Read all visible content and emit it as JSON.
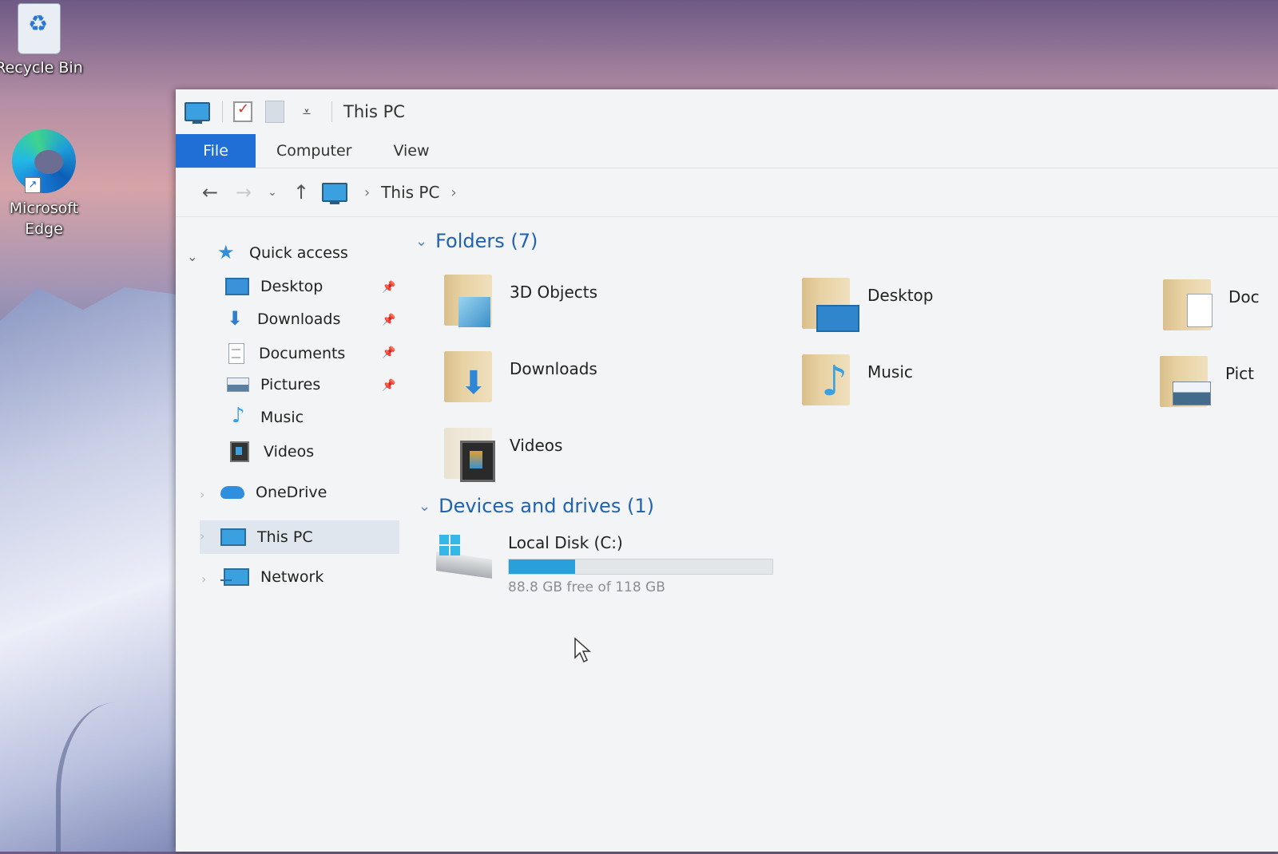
{
  "desktop": {
    "icons": [
      {
        "label": "Recycle Bin",
        "icon": "recycle-bin-icon"
      },
      {
        "label": "Microsoft Edge",
        "icon": "edge-icon"
      }
    ]
  },
  "window": {
    "title": "This PC",
    "ribbon_tabs": [
      {
        "label": "File"
      },
      {
        "label": "Computer"
      },
      {
        "label": "View"
      }
    ],
    "address": {
      "crumbs": [
        "This PC"
      ]
    }
  },
  "nav": {
    "quick_access": "Quick access",
    "quick_items": [
      {
        "label": "Desktop",
        "icon": "desktop-icon",
        "pinned": true
      },
      {
        "label": "Downloads",
        "icon": "downloads-icon",
        "pinned": true
      },
      {
        "label": "Documents",
        "icon": "documents-icon",
        "pinned": true
      },
      {
        "label": "Pictures",
        "icon": "pictures-icon",
        "pinned": true
      },
      {
        "label": "Music",
        "icon": "music-icon",
        "pinned": false
      },
      {
        "label": "Videos",
        "icon": "videos-icon",
        "pinned": false
      }
    ],
    "onedrive": "OneDrive",
    "this_pc": "This PC",
    "network": "Network"
  },
  "content": {
    "folders_header": "Folders (7)",
    "folders": [
      {
        "label": "3D Objects",
        "icon": "3d-objects-icon"
      },
      {
        "label": "Desktop",
        "icon": "desktop-folder-icon"
      },
      {
        "label": "Doc",
        "icon": "documents-folder-icon"
      },
      {
        "label": "Downloads",
        "icon": "downloads-folder-icon"
      },
      {
        "label": "Music",
        "icon": "music-folder-icon"
      },
      {
        "label": "Pict",
        "icon": "pictures-folder-icon"
      },
      {
        "label": "Videos",
        "icon": "videos-folder-icon"
      }
    ],
    "drives_header": "Devices and drives (1)",
    "drive": {
      "label": "Local Disk (C:)",
      "free_text": "88.8 GB free of 118 GB",
      "used_fraction": 0.25
    }
  },
  "colors": {
    "file_tab": "#1f6fd6",
    "group_header": "#1f62b0",
    "drive_fill": "#2aa0d8"
  }
}
